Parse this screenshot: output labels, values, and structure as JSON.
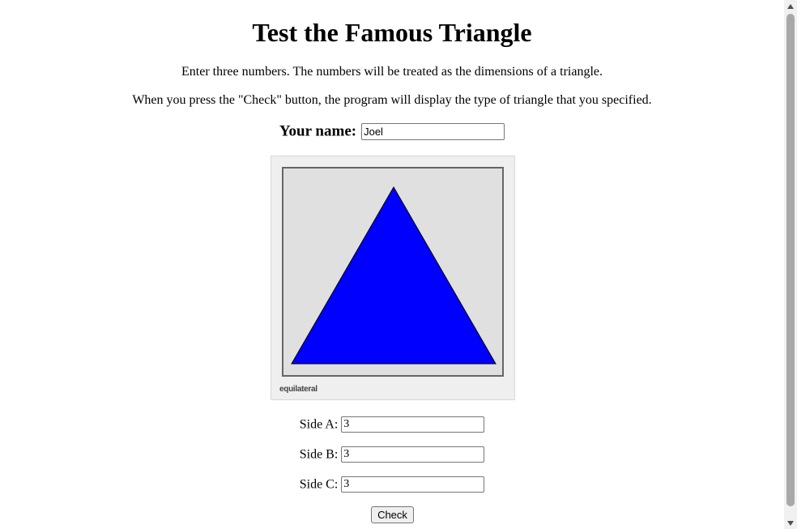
{
  "page": {
    "title": "Test the Famous Triangle",
    "instructions_1": "Enter three numbers. The numbers will be treated as the dimensions of a triangle.",
    "instructions_2": "When you press the \"Check\" button, the program will display the type of triangle that you specified."
  },
  "name_field": {
    "label": "Your name:",
    "value": "Joel"
  },
  "triangle_display": {
    "type_label": "equilateral",
    "fill_color": "#0000ff",
    "background_color": "#e0e0e0"
  },
  "sides": [
    {
      "label": "Side A:",
      "value": "3"
    },
    {
      "label": "Side B:",
      "value": "3"
    },
    {
      "label": "Side C:",
      "value": "3"
    }
  ],
  "check_button": {
    "label": "Check"
  }
}
